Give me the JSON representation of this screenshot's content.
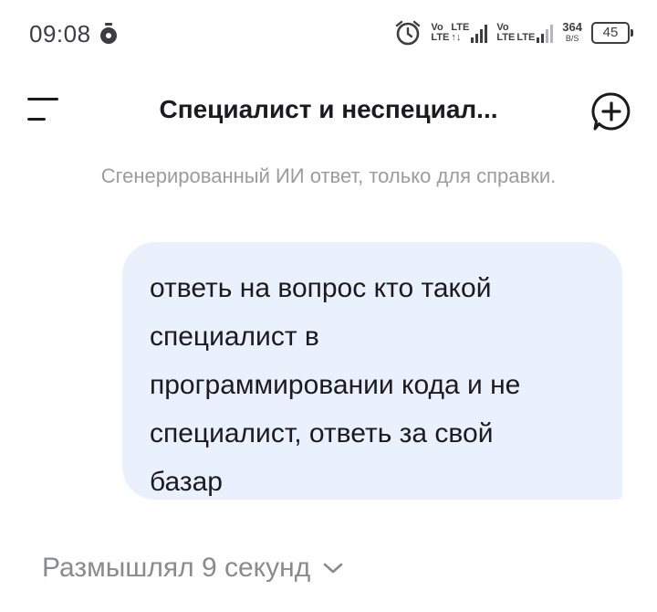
{
  "status_bar": {
    "time": "09:08",
    "network": [
      {
        "top": "Vo",
        "bottom": "LTE"
      },
      {
        "top": "LTE",
        "bottom": "↑↓"
      },
      {
        "top": "Vo",
        "bottom": "LTE"
      },
      {
        "top": "LTE",
        "bottom": ""
      }
    ],
    "speed_value": "364",
    "speed_unit": "B/S",
    "battery": "45"
  },
  "header": {
    "title": "Специалист и неспециал..."
  },
  "disclaimer": "Сгенерированный ИИ ответ, только для справки.",
  "messages": [
    {
      "role": "user",
      "text": "ответь на вопрос кто такой специалист в программировании кода и не специалист, ответь за свой базар"
    }
  ],
  "thinking": {
    "label": "Размышлял 9 секунд"
  },
  "icons": {
    "menu": "menu-icon",
    "new_chat": "new-chat-icon",
    "alarm": "alarm-icon",
    "expand": "chevron-down-icon"
  },
  "colors": {
    "bubble": "#eaf1fd",
    "muted": "#9b9ba3",
    "text": "#1b1b1f"
  }
}
